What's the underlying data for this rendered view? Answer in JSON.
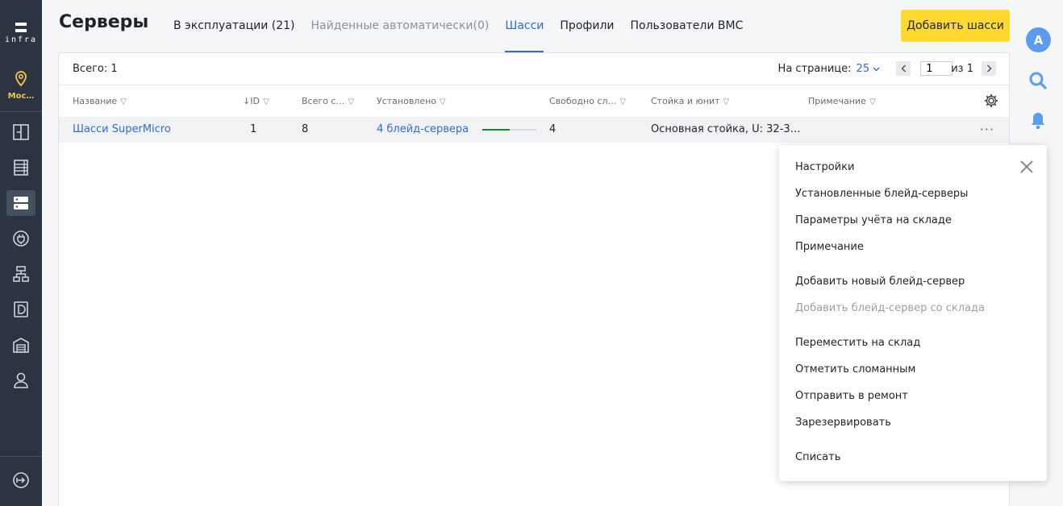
{
  "sidebar": {
    "logo_text": "infra",
    "location_label": "Мос…"
  },
  "header": {
    "title": "Серверы",
    "tabs": [
      {
        "label": "В эксплуатации (21)"
      },
      {
        "label": "Найденные автоматически(0)"
      },
      {
        "label": "Шасси"
      },
      {
        "label": "Профили"
      },
      {
        "label": "Пользователи BMC"
      }
    ],
    "add_button": "Добавить шасси"
  },
  "user": {
    "avatar_letter": "A"
  },
  "table": {
    "total_label": "Всего: 1",
    "per_page_label": "На странице:",
    "per_page_value": "25",
    "page_value": "1",
    "page_of": "из 1",
    "columns": [
      {
        "label": "Название"
      },
      {
        "label": "↓ID"
      },
      {
        "label": "Всего с…"
      },
      {
        "label": "Установлено"
      },
      {
        "label": "Свободно сл…"
      },
      {
        "label": "Стойка и юнит"
      },
      {
        "label": "Примечание"
      }
    ],
    "rows": [
      {
        "name": "Шасси SuperMicro",
        "id": "1",
        "total_slots": "8",
        "installed": "4 блейд-сервера",
        "installed_fraction": 0.5,
        "free_slots": "4",
        "rack": "Основная стойка, U: 32-3…",
        "note": ""
      }
    ]
  },
  "context_menu": {
    "items": [
      {
        "label": "Настройки",
        "disabled": false
      },
      {
        "label": "Установленные блейд-серверы",
        "disabled": false
      },
      {
        "label": "Параметры учёта на складе",
        "disabled": false
      },
      {
        "label": "Примечание",
        "disabled": false
      },
      {
        "label": "Добавить новый блейд-сервер",
        "disabled": false
      },
      {
        "label": "Добавить блейд-сервер со склада",
        "disabled": true
      },
      {
        "label": "Переместить на склад",
        "disabled": false
      },
      {
        "label": "Отметить сломанным",
        "disabled": false
      },
      {
        "label": "Отправить в ремонт",
        "disabled": false
      },
      {
        "label": "Зарезервировать",
        "disabled": false
      },
      {
        "label": "Списать",
        "disabled": false
      }
    ]
  },
  "colors": {
    "sidebar_bg": "#2b3440",
    "accent_blue": "#2e6bd6",
    "primary_button": "#ffd930",
    "location_yellow": "#f2c94c",
    "progress_green": "#1a7f37"
  },
  "icons": [
    "logo-icon",
    "location-pin-icon",
    "rack-icon",
    "cabinet-icon",
    "server-icon",
    "power-plug-icon",
    "network-icon",
    "storage-disk-icon",
    "warehouse-icon",
    "user-icon",
    "logout-icon",
    "search-icon",
    "bell-icon",
    "gear-icon",
    "filter-icon",
    "close-icon",
    "more-icon",
    "chevron-down-icon",
    "chevron-left-icon",
    "chevron-right-icon"
  ]
}
